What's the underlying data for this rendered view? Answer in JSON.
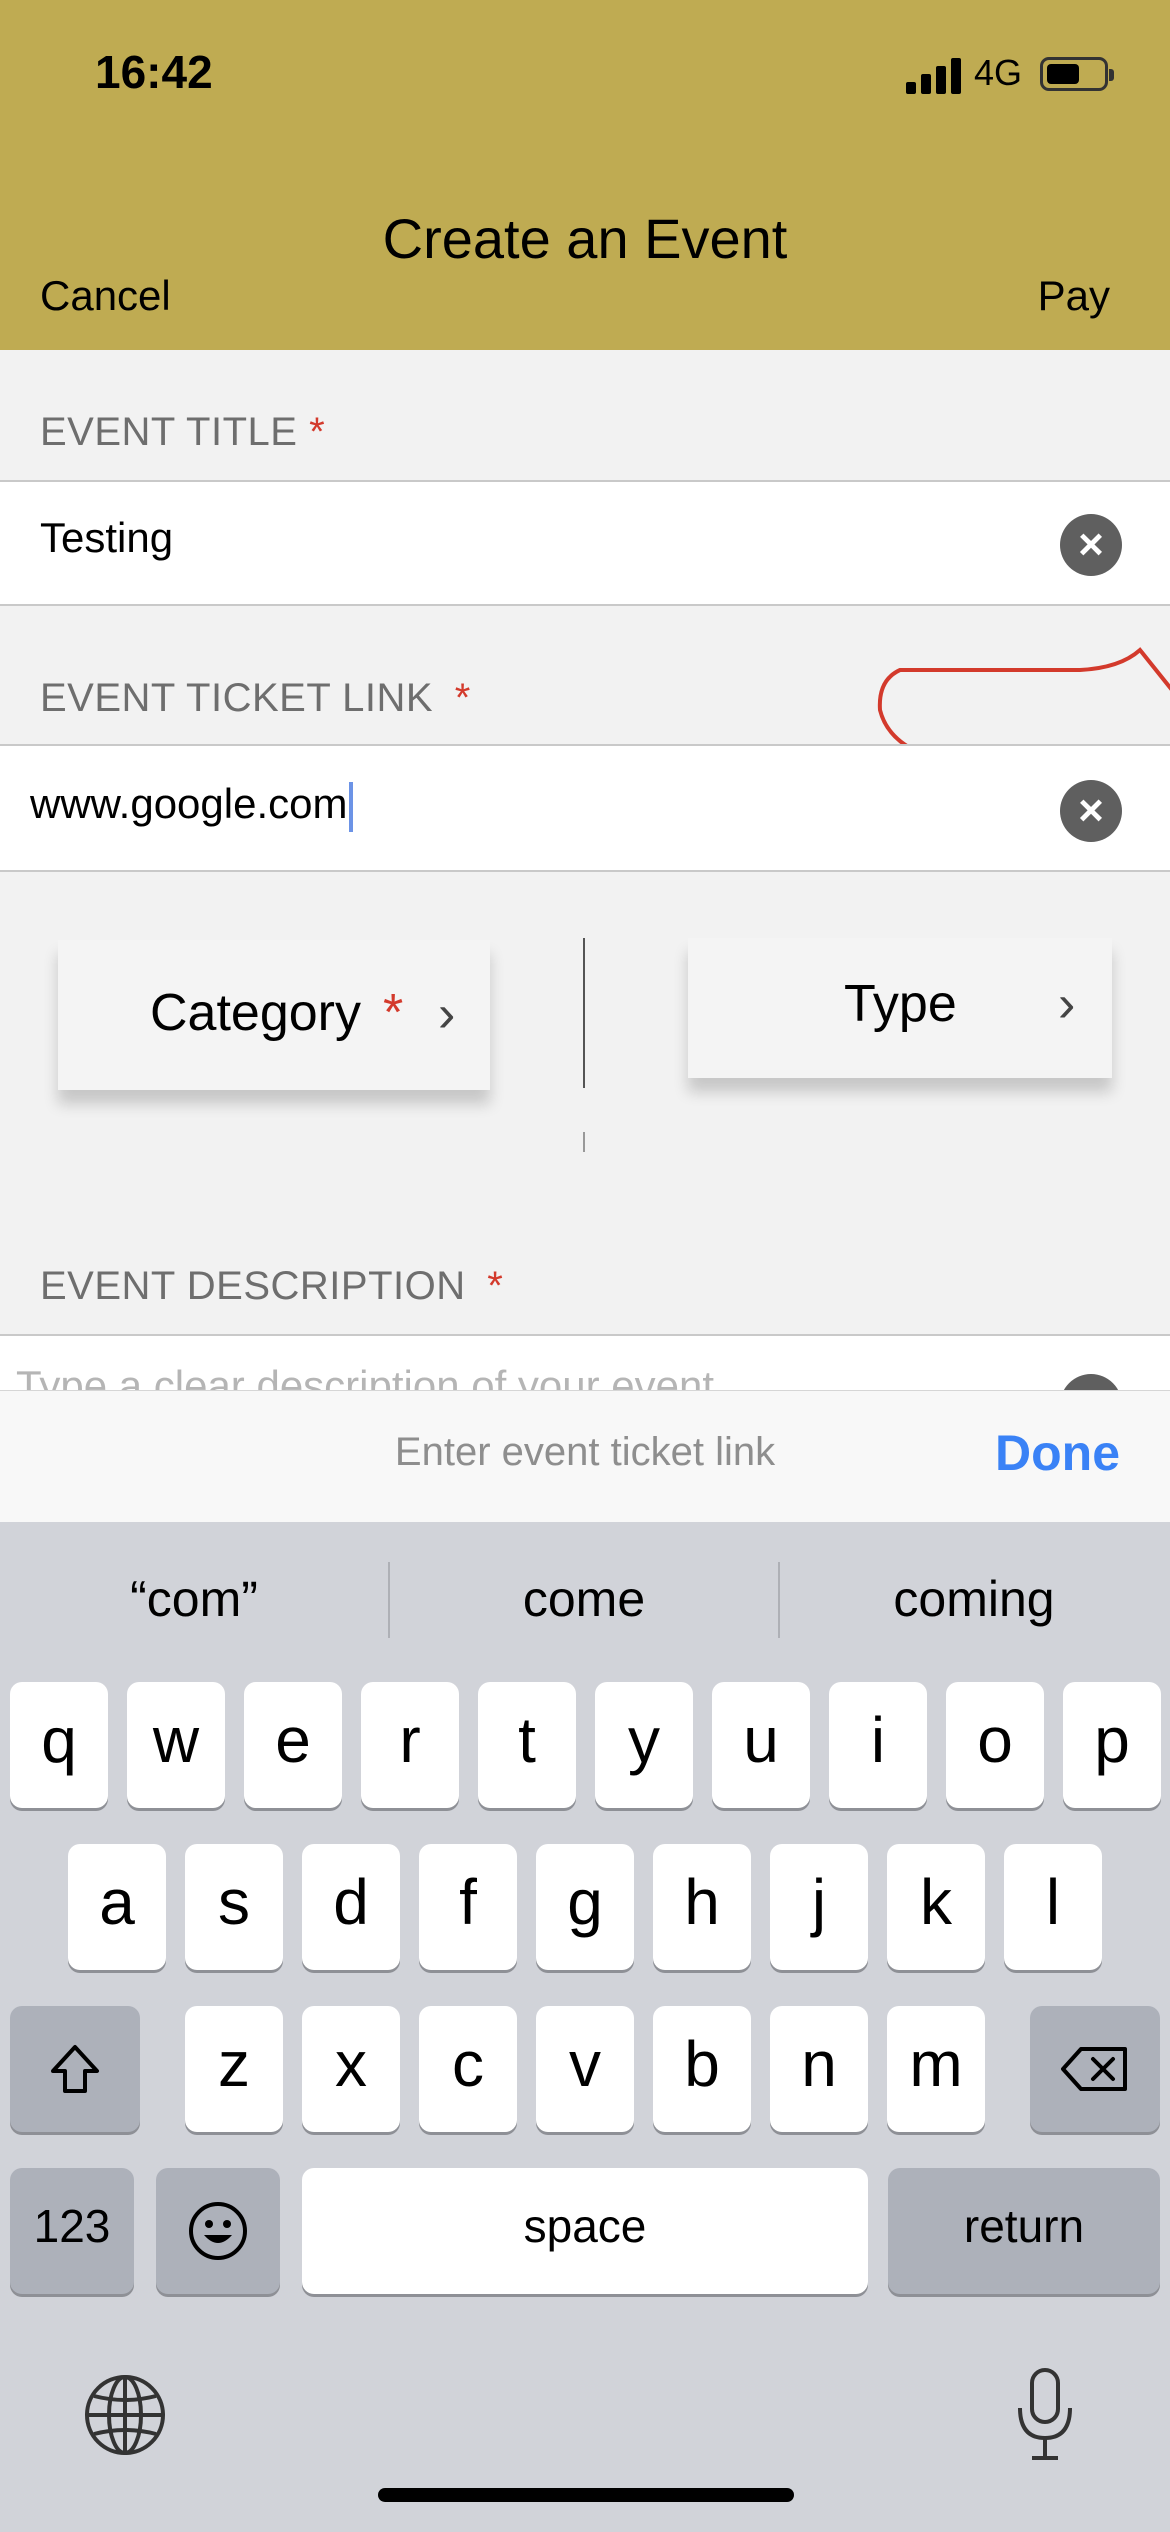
{
  "status_bar": {
    "time": "16:42",
    "network": "4G"
  },
  "header": {
    "title": "Create an Event",
    "cancel_label": "Cancel",
    "pay_label": "Pay"
  },
  "form": {
    "event_title": {
      "label": "EVENT TITLE",
      "required_mark": "*",
      "value": "Testing"
    },
    "event_ticket_link": {
      "label": "EVENT TICKET LINK",
      "required_mark": "*",
      "value": "www.google.com"
    },
    "category": {
      "label": "Category",
      "required_mark": "*"
    },
    "type": {
      "label": "Type"
    },
    "event_description": {
      "label": "EVENT DESCRIPTION",
      "required_mark": "*",
      "placeholder": "Type a clear description of your event"
    }
  },
  "accessory_bar": {
    "hint": "Enter event ticket link",
    "done_label": "Done"
  },
  "keyboard": {
    "suggestions": [
      "“com”",
      "come",
      "coming"
    ],
    "row1": [
      "q",
      "w",
      "e",
      "r",
      "t",
      "y",
      "u",
      "i",
      "o",
      "p"
    ],
    "row2": [
      "a",
      "s",
      "d",
      "f",
      "g",
      "h",
      "j",
      "k",
      "l"
    ],
    "row3": [
      "z",
      "x",
      "c",
      "v",
      "b",
      "n",
      "m"
    ],
    "numbers_label": "123",
    "space_label": "space",
    "return_label": "return"
  },
  "colors": {
    "header": "#bfab52",
    "required": "#d33a2c",
    "done": "#3a82f6",
    "annotation": "#d33a2c"
  }
}
